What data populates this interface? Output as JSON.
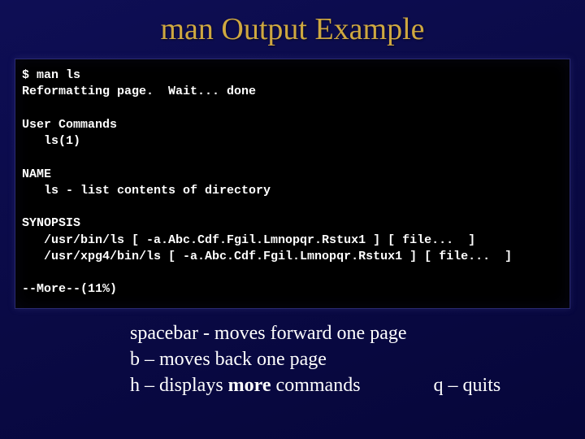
{
  "title": "man Output Example",
  "terminal": {
    "line1": "$ man ls",
    "line2": "Reformatting page.  Wait... done",
    "blank1": "",
    "line3": "User Commands",
    "line4": "   ls(1)",
    "blank2": "",
    "line5": "NAME",
    "line6": "   ls - list contents of directory",
    "blank3": "",
    "line7": "SYNOPSIS",
    "line8": "   /usr/bin/ls [ -a.Abc.Cdf.Fgil.Lmnopqr.Rstux1 ] [ file...  ]",
    "line9": "   /usr/xpg4/bin/ls [ -a.Abc.Cdf.Fgil.Lmnopqr.Rstux1 ] [ file...  ]",
    "blank4": "",
    "line10": "--More--(11%)"
  },
  "hints": {
    "h1": "spacebar - moves forward one page",
    "h2": "b – moves back one page",
    "h3a": "h – displays ",
    "h3b_bold": "more",
    "h3c": " commands",
    "h4": "q – quits"
  }
}
